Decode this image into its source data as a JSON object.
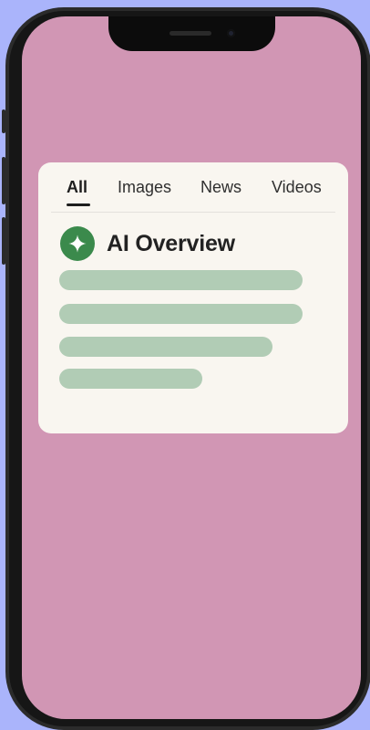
{
  "tabs": [
    {
      "label": "All",
      "active": true
    },
    {
      "label": "Images",
      "active": false
    },
    {
      "label": "News",
      "active": false
    },
    {
      "label": "Videos",
      "active": false
    }
  ],
  "ai_overview": {
    "title": "AI Overview",
    "icon": "sparkle-icon"
  },
  "colors": {
    "background": "#aab4fb",
    "screen": "#d196b4",
    "card": "#f9f6f0",
    "accent": "#3b8a4c",
    "placeholder": "#b1ccb5"
  }
}
